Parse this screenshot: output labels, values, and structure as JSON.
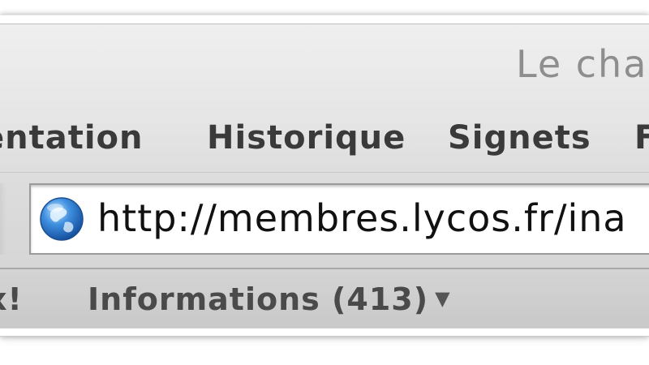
{
  "window": {
    "title": "Le cha"
  },
  "menubar": {
    "items": [
      {
        "label": "entation"
      },
      {
        "label": "Historique"
      },
      {
        "label": "Signets"
      },
      {
        "label": "F"
      }
    ]
  },
  "urlbar": {
    "value": "http://membres.lycos.fr/ina",
    "icon": "globe-icon"
  },
  "bookmarks": {
    "items": [
      {
        "label": "x!"
      },
      {
        "label": "Informations (413)"
      }
    ]
  },
  "colors": {
    "title_text": "#8e8e8e",
    "menu_text": "#3a3a3a",
    "bookmark_text": "#4a4a4a",
    "globe_blue": "#2a6fc4"
  }
}
